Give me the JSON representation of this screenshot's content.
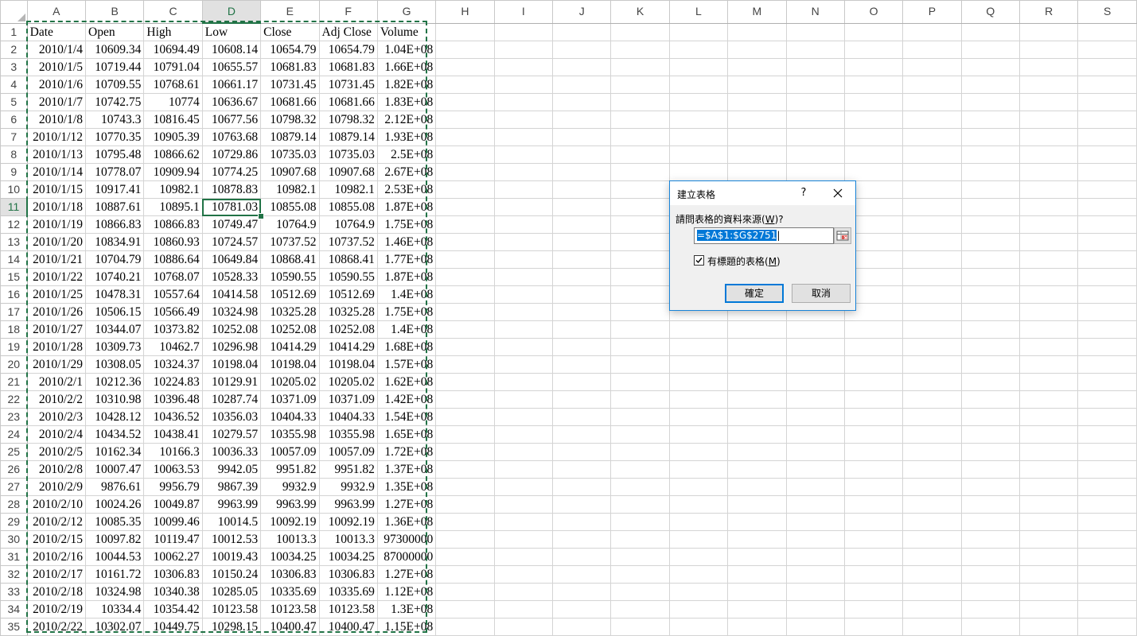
{
  "columns": [
    "A",
    "B",
    "C",
    "D",
    "E",
    "F",
    "G",
    "H",
    "I",
    "J",
    "K",
    "L",
    "M",
    "N",
    "O",
    "P",
    "Q",
    "R",
    "S"
  ],
  "selected_column": "D",
  "selected_row": "11",
  "header_row": [
    "Date",
    "Open",
    "High",
    "Low",
    "Close",
    "Adj Close",
    "Volume"
  ],
  "rows": [
    [
      "2",
      "2010/1/4",
      "10609.34",
      "10694.49",
      "10608.14",
      "10654.79",
      "10654.79",
      "1.04E+08"
    ],
    [
      "3",
      "2010/1/5",
      "10719.44",
      "10791.04",
      "10655.57",
      "10681.83",
      "10681.83",
      "1.66E+08"
    ],
    [
      "4",
      "2010/1/6",
      "10709.55",
      "10768.61",
      "10661.17",
      "10731.45",
      "10731.45",
      "1.82E+08"
    ],
    [
      "5",
      "2010/1/7",
      "10742.75",
      "10774",
      "10636.67",
      "10681.66",
      "10681.66",
      "1.83E+08"
    ],
    [
      "6",
      "2010/1/8",
      "10743.3",
      "10816.45",
      "10677.56",
      "10798.32",
      "10798.32",
      "2.12E+08"
    ],
    [
      "7",
      "2010/1/12",
      "10770.35",
      "10905.39",
      "10763.68",
      "10879.14",
      "10879.14",
      "1.93E+08"
    ],
    [
      "8",
      "2010/1/13",
      "10795.48",
      "10866.62",
      "10729.86",
      "10735.03",
      "10735.03",
      "2.5E+08"
    ],
    [
      "9",
      "2010/1/14",
      "10778.07",
      "10909.94",
      "10774.25",
      "10907.68",
      "10907.68",
      "2.67E+08"
    ],
    [
      "10",
      "2010/1/15",
      "10917.41",
      "10982.1",
      "10878.83",
      "10982.1",
      "10982.1",
      "2.53E+08"
    ],
    [
      "11",
      "2010/1/18",
      "10887.61",
      "10895.1",
      "10781.03",
      "10855.08",
      "10855.08",
      "1.87E+08"
    ],
    [
      "12",
      "2010/1/19",
      "10866.83",
      "10866.83",
      "10749.47",
      "10764.9",
      "10764.9",
      "1.75E+08"
    ],
    [
      "13",
      "2010/1/20",
      "10834.91",
      "10860.93",
      "10724.57",
      "10737.52",
      "10737.52",
      "1.46E+08"
    ],
    [
      "14",
      "2010/1/21",
      "10704.79",
      "10886.64",
      "10649.84",
      "10868.41",
      "10868.41",
      "1.77E+08"
    ],
    [
      "15",
      "2010/1/22",
      "10740.21",
      "10768.07",
      "10528.33",
      "10590.55",
      "10590.55",
      "1.87E+08"
    ],
    [
      "16",
      "2010/1/25",
      "10478.31",
      "10557.64",
      "10414.58",
      "10512.69",
      "10512.69",
      "1.4E+08"
    ],
    [
      "17",
      "2010/1/26",
      "10506.15",
      "10566.49",
      "10324.98",
      "10325.28",
      "10325.28",
      "1.75E+08"
    ],
    [
      "18",
      "2010/1/27",
      "10344.07",
      "10373.82",
      "10252.08",
      "10252.08",
      "10252.08",
      "1.4E+08"
    ],
    [
      "19",
      "2010/1/28",
      "10309.73",
      "10462.7",
      "10296.98",
      "10414.29",
      "10414.29",
      "1.68E+08"
    ],
    [
      "20",
      "2010/1/29",
      "10308.05",
      "10324.37",
      "10198.04",
      "10198.04",
      "10198.04",
      "1.57E+08"
    ],
    [
      "21",
      "2010/2/1",
      "10212.36",
      "10224.83",
      "10129.91",
      "10205.02",
      "10205.02",
      "1.62E+08"
    ],
    [
      "22",
      "2010/2/2",
      "10310.98",
      "10396.48",
      "10287.74",
      "10371.09",
      "10371.09",
      "1.42E+08"
    ],
    [
      "23",
      "2010/2/3",
      "10428.12",
      "10436.52",
      "10356.03",
      "10404.33",
      "10404.33",
      "1.54E+08"
    ],
    [
      "24",
      "2010/2/4",
      "10434.52",
      "10438.41",
      "10279.57",
      "10355.98",
      "10355.98",
      "1.65E+08"
    ],
    [
      "25",
      "2010/2/5",
      "10162.34",
      "10166.3",
      "10036.33",
      "10057.09",
      "10057.09",
      "1.72E+08"
    ],
    [
      "26",
      "2010/2/8",
      "10007.47",
      "10063.53",
      "9942.05",
      "9951.82",
      "9951.82",
      "1.37E+08"
    ],
    [
      "27",
      "2010/2/9",
      "9876.61",
      "9956.79",
      "9867.39",
      "9932.9",
      "9932.9",
      "1.35E+08"
    ],
    [
      "28",
      "2010/2/10",
      "10024.26",
      "10049.87",
      "9963.99",
      "9963.99",
      "9963.99",
      "1.27E+08"
    ],
    [
      "29",
      "2010/2/12",
      "10085.35",
      "10099.46",
      "10014.5",
      "10092.19",
      "10092.19",
      "1.36E+08"
    ],
    [
      "30",
      "2010/2/15",
      "10097.82",
      "10119.47",
      "10012.53",
      "10013.3",
      "10013.3",
      "97300000"
    ],
    [
      "31",
      "2010/2/16",
      "10044.53",
      "10062.27",
      "10019.43",
      "10034.25",
      "10034.25",
      "87000000"
    ],
    [
      "32",
      "2010/2/17",
      "10161.72",
      "10306.83",
      "10150.24",
      "10306.83",
      "10306.83",
      "1.27E+08"
    ],
    [
      "33",
      "2010/2/18",
      "10324.98",
      "10340.38",
      "10285.05",
      "10335.69",
      "10335.69",
      "1.12E+08"
    ],
    [
      "34",
      "2010/2/19",
      "10334.4",
      "10354.42",
      "10123.58",
      "10123.58",
      "10123.58",
      "1.3E+08"
    ],
    [
      "35",
      "2010/2/22",
      "10302.07",
      "10449.75",
      "10298.15",
      "10400.47",
      "10400.47",
      "1.15E+08"
    ]
  ],
  "dialog": {
    "title": "建立表格",
    "help": "?",
    "prompt_text": "請問表格的資料來源(",
    "prompt_key": "W",
    "prompt_end": ")?",
    "range_value": "=$A$1:$G$2751",
    "checkbox_text": "有標題的表格(",
    "checkbox_key": "M",
    "checkbox_end": ")",
    "checkbox_checked": true,
    "ok_label": "確定",
    "cancel_label": "取消"
  },
  "colors": {
    "accent": "#217346",
    "dialog_border": "#1883d7",
    "selection": "#0078d7"
  }
}
